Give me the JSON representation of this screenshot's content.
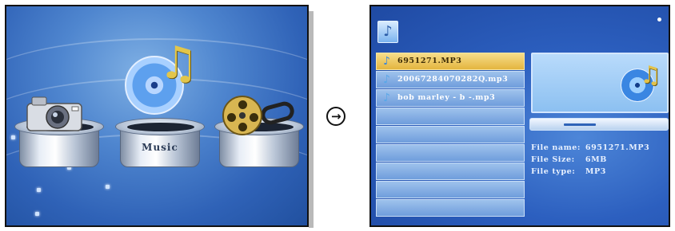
{
  "left_screen": {
    "pedestals": [
      {
        "label": "",
        "icon": "camera-icon"
      },
      {
        "label": "Music",
        "icon": "music-disc-icon"
      },
      {
        "label": "",
        "icon": "film-reel-icon"
      }
    ]
  },
  "transition_icon": "arrow-right-circle-icon",
  "right_screen": {
    "files": [
      {
        "name": "6951271.MP3",
        "selected": true
      },
      {
        "name": "20067284070282Q.mp3",
        "selected": false
      },
      {
        "name": "bob marley - b -.mp3",
        "selected": false
      }
    ],
    "info": {
      "name_label": "File name:",
      "name_value": "6951271.MP3",
      "size_label": "File Size:",
      "size_value": "6MB",
      "type_label": "File type:",
      "type_value": "MP3"
    },
    "progress": 0.46
  },
  "colors": {
    "screen_blue": "#2c5fbf",
    "highlight_gold": "#e4b53f",
    "row_blue": "#8fb5e6"
  }
}
